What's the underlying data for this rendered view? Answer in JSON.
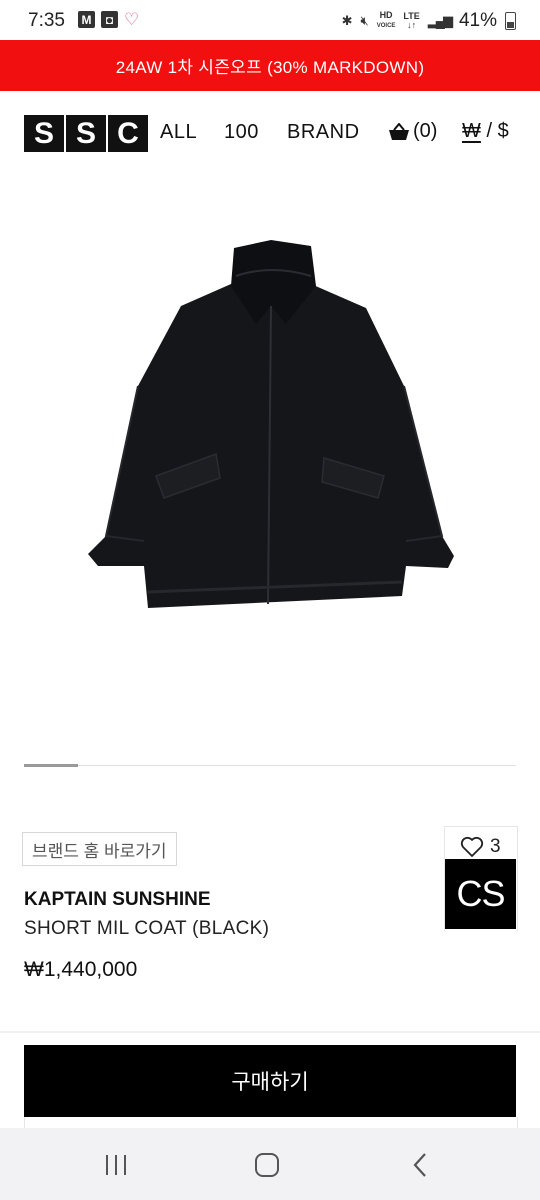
{
  "status_bar": {
    "time": "7:35",
    "left_icons": [
      "gmail-icon",
      "calendar-icon",
      "heart-icon"
    ],
    "hd_label": "HD",
    "hd_sub": "VOICE",
    "network": "LTE",
    "battery": "41%"
  },
  "promo_banner": "24AW 1차 시즌오프 (30% MARKDOWN)",
  "header": {
    "logo_letters": [
      "S",
      "S",
      "C"
    ],
    "nav": [
      "ALL",
      "100",
      "BRAND"
    ],
    "cart_count": "(0)",
    "currency_won": "₩",
    "currency_sep": "/",
    "currency_usd": "$"
  },
  "image_slider": {
    "current": 1,
    "total": 9
  },
  "product": {
    "brand_home_label": "브랜드 홈 바로가기",
    "like_count": "3",
    "brand_logo": "CS",
    "brand": "KAPTAIN SUNSHINE",
    "name": "SHORT MIL COAT (BLACK)",
    "price": "₩1,440,000"
  },
  "buy_button": "구매하기",
  "colors": {
    "promo": "#f20f10",
    "button": "#000000"
  }
}
